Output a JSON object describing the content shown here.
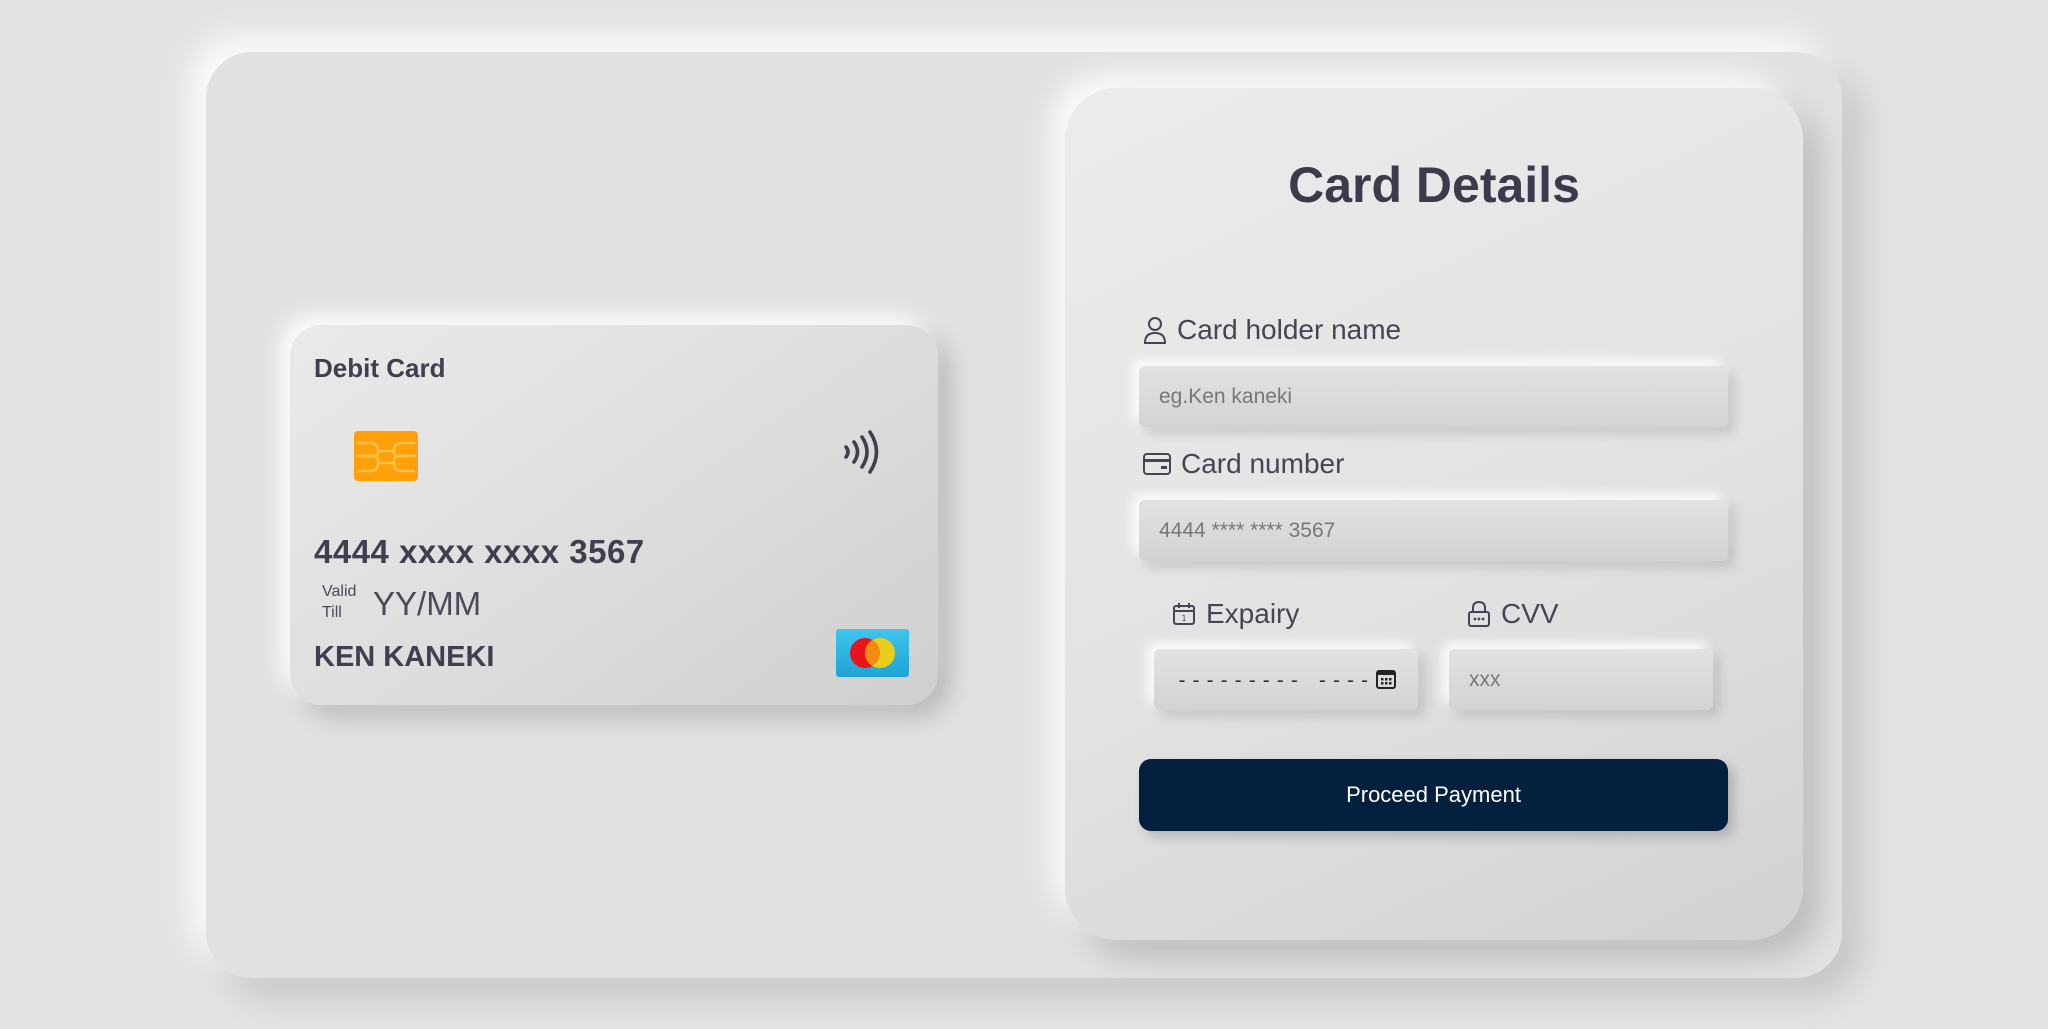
{
  "card": {
    "type_label": "Debit Card",
    "number": "4444 xxxx xxxx 3567",
    "valid_label_1": "Valid",
    "valid_label_2": "Till",
    "valid_value": "YY/MM",
    "holder": "KEN KANEKI",
    "chip_icon": "chip-icon",
    "contactless_icon": "contactless-icon",
    "brand_icon": "mastercard-logo",
    "colors": {
      "chip": "#ff9f0a",
      "mastercard_red": "#e8141b",
      "mastercard_yellow": "#f5cf12",
      "logo_bg": "#2eb6e4"
    }
  },
  "form": {
    "title": "Card Details",
    "holder": {
      "label": "Card holder name",
      "icon": "user-icon",
      "placeholder": "eg.Ken kaneki"
    },
    "number": {
      "label": "Card number",
      "icon": "credit-card-icon",
      "placeholder": "4444 **** **** 3567"
    },
    "expiry": {
      "label": "Expairy",
      "icon": "calendar-icon",
      "value": "--------- ----",
      "picker_icon": "calendar-picker-icon"
    },
    "cvv": {
      "label": "CVV",
      "icon": "lock-icon",
      "placeholder": "xxx"
    },
    "submit_label": "Proceed Payment",
    "colors": {
      "button_bg": "#04203e",
      "button_text": "#ffffff",
      "title": "#3b3b4c"
    }
  }
}
